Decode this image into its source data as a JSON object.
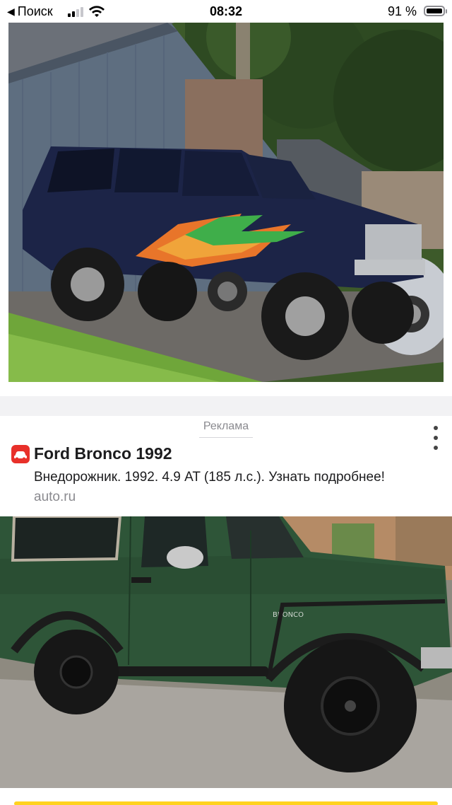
{
  "status_bar": {
    "back_label": "Поиск",
    "time": "08:32",
    "battery_percent": "91 %",
    "battery_level": 0.91,
    "signal_bars_active": 2
  },
  "ad": {
    "label": "Реклама",
    "title": "Ford Bronco 1992",
    "description": "Внедорожник. 1992. 4.9 AT (185 л.с.). Узнать подробнее!",
    "domain": "auto.ru",
    "brand_color": "#e8302a"
  },
  "photos": {
    "top_icon": "lifted-suv-photo",
    "ad_icon": "green-ford-bronco-photo",
    "badge_text": "BRONCO"
  },
  "colors": {
    "ad_accent": "#ffd21f"
  }
}
